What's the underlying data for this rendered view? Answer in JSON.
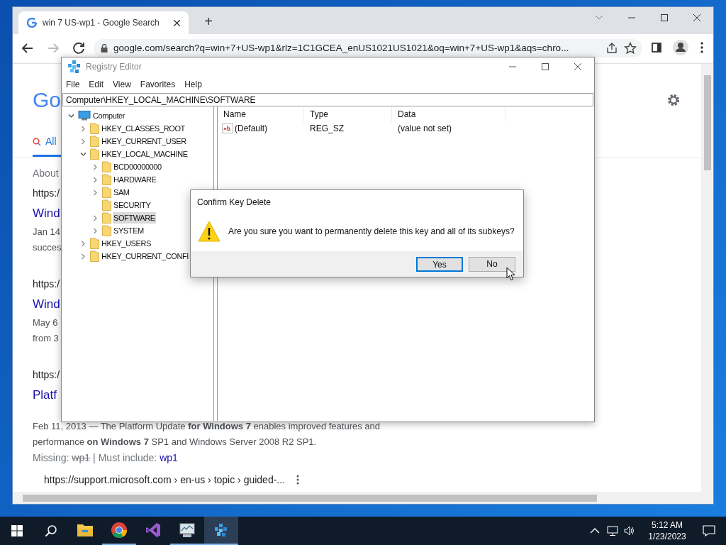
{
  "browser": {
    "tab": {
      "title": "win 7 US-wp1 - Google Search",
      "selected": true
    },
    "new_tab": "+",
    "address": "google.com/search?q=win+7+US-wp1&rlz=1C1GCEA_enUS1021US1021&oq=win+7+US-wp1&aqs=chro..."
  },
  "search_page": {
    "logo": "Go",
    "tabs": [
      {
        "label": "All",
        "selected": true
      }
    ],
    "about": "About",
    "results": [
      {
        "url": "https:/",
        "title": "Wind",
        "lines": [
          "Jan 14",
          "succes"
        ]
      },
      {
        "url": "https:/",
        "title": "Wind",
        "lines": [
          "May 6",
          "from 3"
        ]
      },
      {
        "url": "https:/",
        "title": "Platf",
        "lines": [
          "Feb 11, 2013 — The Platform Update **for Windows 7** enables improved features and",
          "performance **on Windows 7** SP1 and Windows Server 2008 R2 SP1."
        ]
      }
    ],
    "missing": {
      "label": "Missing:",
      "term": "wp1",
      "separator": "|",
      "include_label": "Must include:",
      "include_term": "wp1"
    },
    "next_url": "https://support.microsoft.com › en-us › topic › guided-..."
  },
  "registry_editor": {
    "title": "Registry Editor",
    "menu": [
      "File",
      "Edit",
      "View",
      "Favorites",
      "Help"
    ],
    "address": "Computer\\HKEY_LOCAL_MACHINE\\SOFTWARE",
    "tree": [
      {
        "label": "Computer",
        "kind": "computer",
        "expandable": true,
        "expanded": true,
        "selected": false,
        "children": [
          {
            "label": "HKEY_CLASSES_ROOT",
            "kind": "folder",
            "expandable": true,
            "expanded": false,
            "selected": false
          },
          {
            "label": "HKEY_CURRENT_USER",
            "kind": "folder",
            "expandable": true,
            "expanded": false,
            "selected": false
          },
          {
            "label": "HKEY_LOCAL_MACHINE",
            "kind": "folder",
            "expandable": true,
            "expanded": true,
            "selected": false,
            "children": [
              {
                "label": "BCD00000000",
                "kind": "folder",
                "expandable": true,
                "expanded": false,
                "selected": false
              },
              {
                "label": "HARDWARE",
                "kind": "folder",
                "expandable": true,
                "expanded": false,
                "selected": false
              },
              {
                "label": "SAM",
                "kind": "folder",
                "expandable": true,
                "expanded": false,
                "selected": false
              },
              {
                "label": "SECURITY",
                "kind": "folder",
                "expandable": false,
                "expanded": false,
                "selected": false
              },
              {
                "label": "SOFTWARE",
                "kind": "folder",
                "expandable": true,
                "expanded": false,
                "selected": true
              },
              {
                "label": "SYSTEM",
                "kind": "folder",
                "expandable": true,
                "expanded": false,
                "selected": false
              }
            ]
          },
          {
            "label": "HKEY_USERS",
            "kind": "folder",
            "expandable": true,
            "expanded": false,
            "selected": false
          },
          {
            "label": "HKEY_CURRENT_CONFI",
            "kind": "folder",
            "expandable": true,
            "expanded": false,
            "selected": false
          }
        ]
      }
    ],
    "columns": [
      "Name",
      "Type",
      "Data"
    ],
    "rows": [
      {
        "name": "(Default)",
        "type": "REG_SZ",
        "data": "(value not set)"
      }
    ]
  },
  "dialog": {
    "title": "Confirm Key Delete",
    "message": "Are you sure you want to permanently delete this key and all of its subkeys?",
    "buttons": [
      {
        "label": "Yes",
        "focused": true
      },
      {
        "label": "No",
        "focused": false
      }
    ]
  },
  "taskbar": {
    "apps": [
      {
        "kind": "explorer",
        "active": false,
        "running": false
      },
      {
        "kind": "chrome",
        "active": false,
        "running": true
      },
      {
        "kind": "studio",
        "active": false,
        "running": false
      },
      {
        "kind": "monitor",
        "active": false,
        "running": true
      },
      {
        "kind": "regedit",
        "active": true,
        "running": true
      }
    ],
    "time": "5:12 AM",
    "date": "1/23/2023"
  }
}
